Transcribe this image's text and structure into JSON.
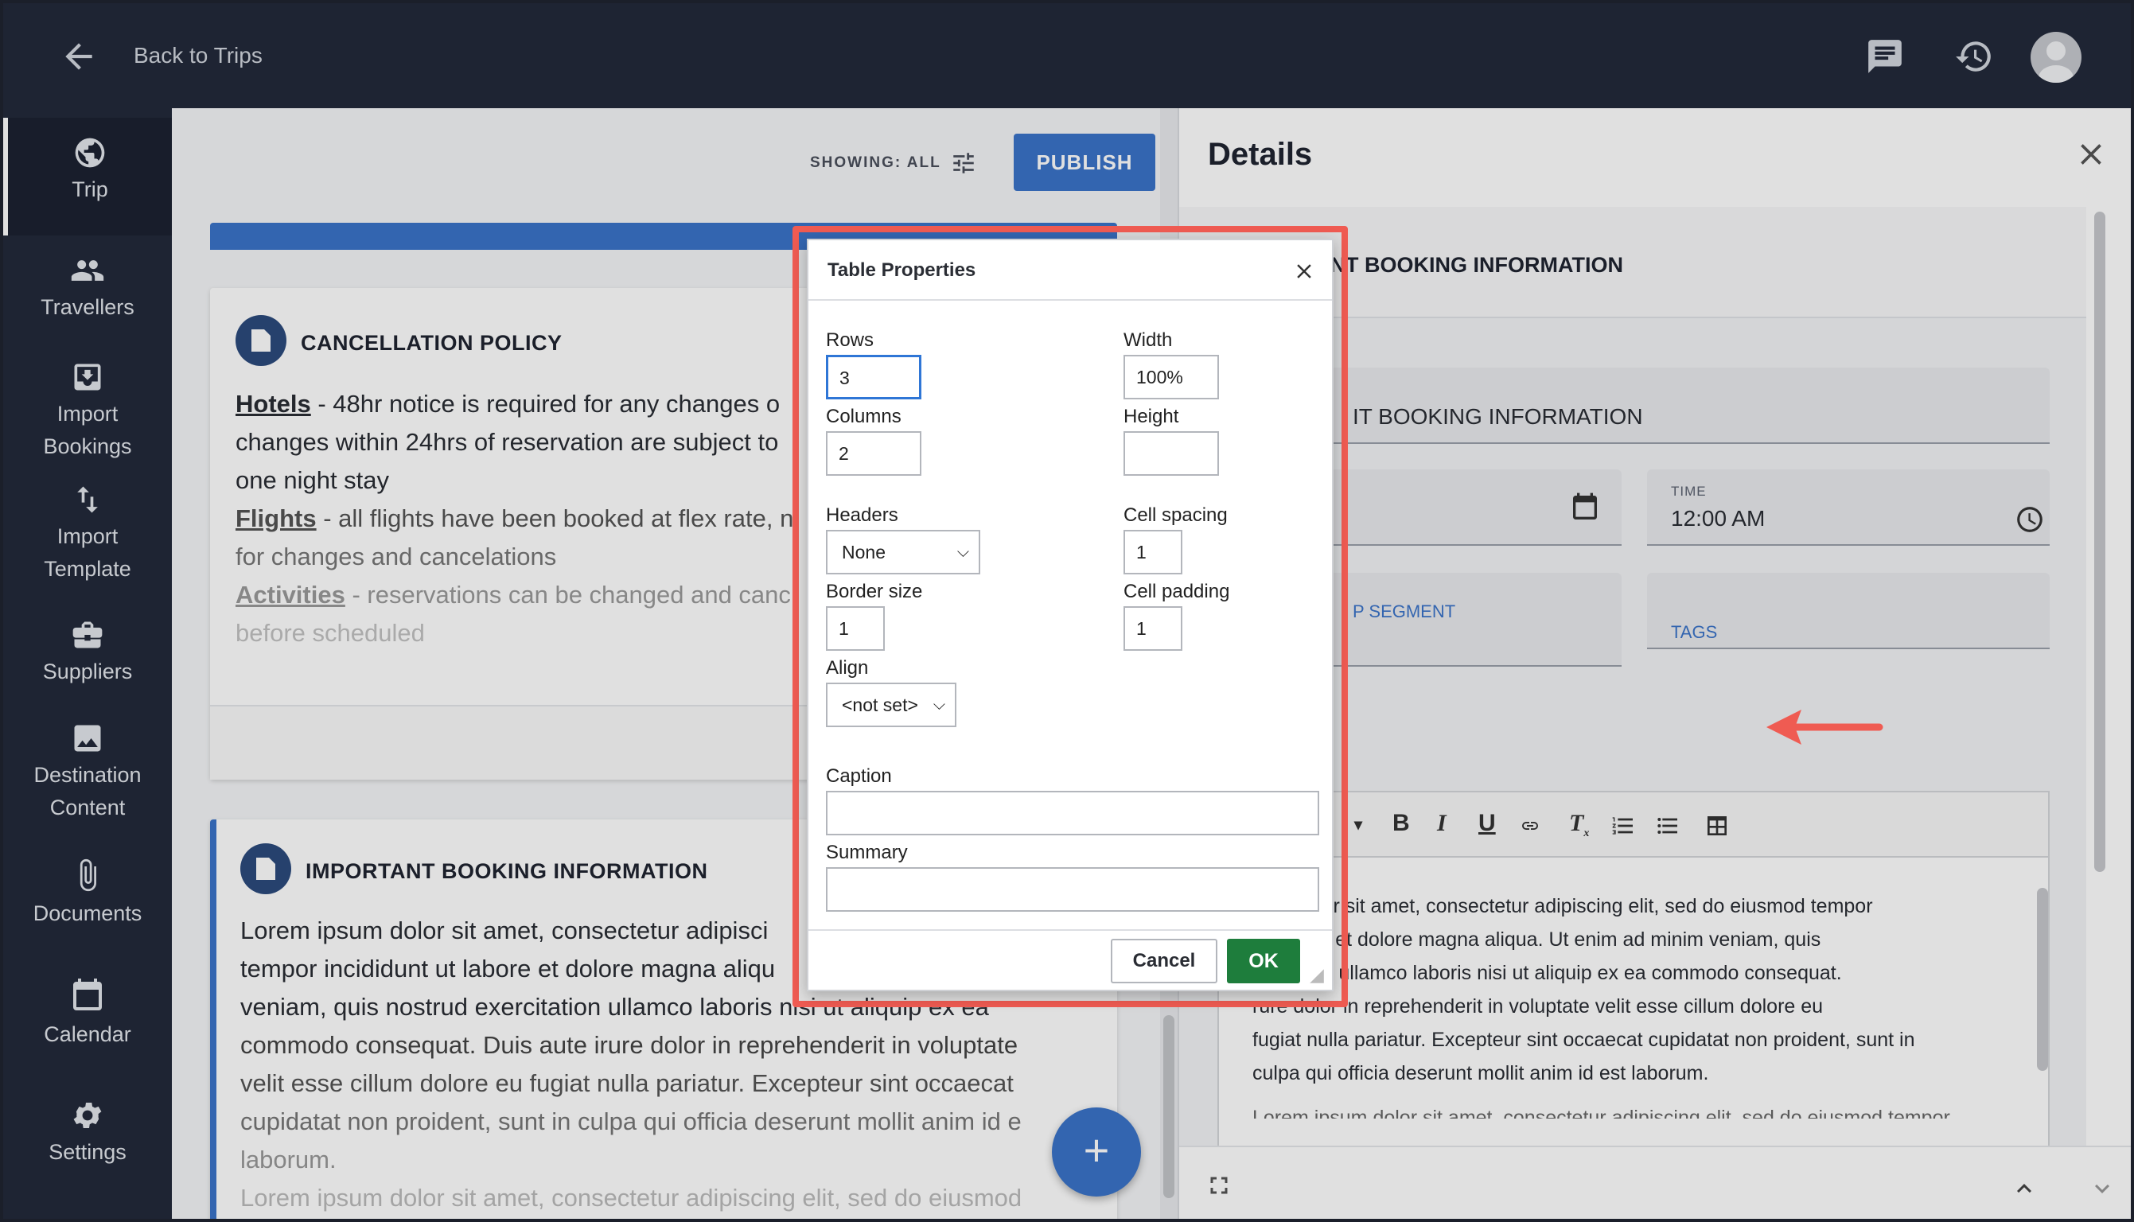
{
  "header": {
    "back_label": "Back to Trips"
  },
  "sidebar": {
    "items": [
      {
        "label_lines": [
          "Trip"
        ],
        "icon": "globe-icon"
      },
      {
        "label_lines": [
          "Travellers"
        ],
        "icon": "people-icon"
      },
      {
        "label_lines": [
          "Import",
          "Bookings"
        ],
        "icon": "import-box-icon"
      },
      {
        "label_lines": [
          "Import",
          "Template"
        ],
        "icon": "swap-vertical-icon"
      },
      {
        "label_lines": [
          "Suppliers"
        ],
        "icon": "briefcase-icon"
      },
      {
        "label_lines": [
          "Destination",
          "Content"
        ],
        "icon": "image-icon"
      },
      {
        "label_lines": [
          "Documents"
        ],
        "icon": "paperclip-icon"
      },
      {
        "label_lines": [
          "Calendar"
        ],
        "icon": "calendar-icon"
      },
      {
        "label_lines": [
          "Settings"
        ],
        "icon": "gear-icon"
      }
    ]
  },
  "main": {
    "showing_label": "SHOWING: ALL",
    "publish_label": "PUBLISH",
    "card1": {
      "title": "CANCELLATION POLICY",
      "lines": [
        {
          "bold": "Hotels",
          "text": " - 48hr notice is required for any changes o"
        },
        {
          "bold": "",
          "text": "changes within 24hrs of reservation are subject to"
        },
        {
          "bold": "",
          "text": "one night stay"
        },
        {
          "bold": "Flights",
          "text": " - all flights have been booked at flex rate, n"
        },
        {
          "bold": "",
          "text": "for changes and cancelations"
        },
        {
          "bold": "Activities",
          "text": " - reservations can be changed and canc"
        },
        {
          "bold": "",
          "text": "before scheduled"
        }
      ]
    },
    "card2": {
      "title": "IMPORTANT BOOKING INFORMATION",
      "lines": [
        "Lorem ipsum dolor sit amet, consectetur adipisci",
        "tempor incididunt ut labore et dolore magna aliqu",
        "veniam, quis nostrud exercitation ullamco laboris nisi ut aliquip ex ea",
        "commodo consequat. Duis aute irure dolor in reprehenderit in voluptate",
        "velit esse cillum dolore eu fugiat nulla pariatur. Excepteur sint occaecat",
        "cupidatat non proident, sunt in culpa qui officia deserunt mollit anim id e",
        "laborum.",
        "Lorem ipsum dolor sit amet, consectetur adipiscing elit, sed do eiusmod"
      ]
    },
    "fab_label": "+"
  },
  "details": {
    "title": "Details",
    "section_title": "ANT BOOKING INFORMATION",
    "name_value": "IT BOOKING INFORMATION",
    "time_label": "TIME",
    "time_value": "12:00 AM",
    "segment_label": "P SEGMENT",
    "tags_label": "TAGS",
    "editor_lines": [
      "sum dolor sit amet, consectetur adipiscing elit, sed do eiusmod tempor",
      "ut labore et dolore magna aliqua. Ut enim ad minim veniam, quis",
      "ercitation ullamco laboris nisi ut aliquip ex ea commodo consequat.",
      "rure dolor in reprehenderit in voluptate velit esse cillum dolore eu",
      "fugiat nulla pariatur. Excepteur sint occaecat cupidatat non proident, sunt in",
      "culpa qui officia deserunt mollit anim id est laborum.",
      "Lorem ipsum dolor sit amet, consectetur adipiscing elit, sed do eiusmod tempor"
    ]
  },
  "dialog": {
    "title": "Table Properties",
    "rows_label": "Rows",
    "rows_value": "3",
    "columns_label": "Columns",
    "columns_value": "2",
    "width_label": "Width",
    "width_value": "100%",
    "height_label": "Height",
    "height_value": "",
    "headers_label": "Headers",
    "headers_value": "None",
    "cell_spacing_label": "Cell spacing",
    "cell_spacing_value": "1",
    "border_size_label": "Border size",
    "border_size_value": "1",
    "cell_padding_label": "Cell padding",
    "cell_padding_value": "1",
    "align_label": "Align",
    "align_value": "<not set>",
    "caption_label": "Caption",
    "caption_value": "",
    "summary_label": "Summary",
    "summary_value": "",
    "cancel_label": "Cancel",
    "ok_label": "OK"
  },
  "colors": {
    "nav_bg": "#232a3b",
    "accent_blue": "#3b74c9",
    "ok_green": "#1e7d3c",
    "highlight_red": "#ef5b52"
  }
}
